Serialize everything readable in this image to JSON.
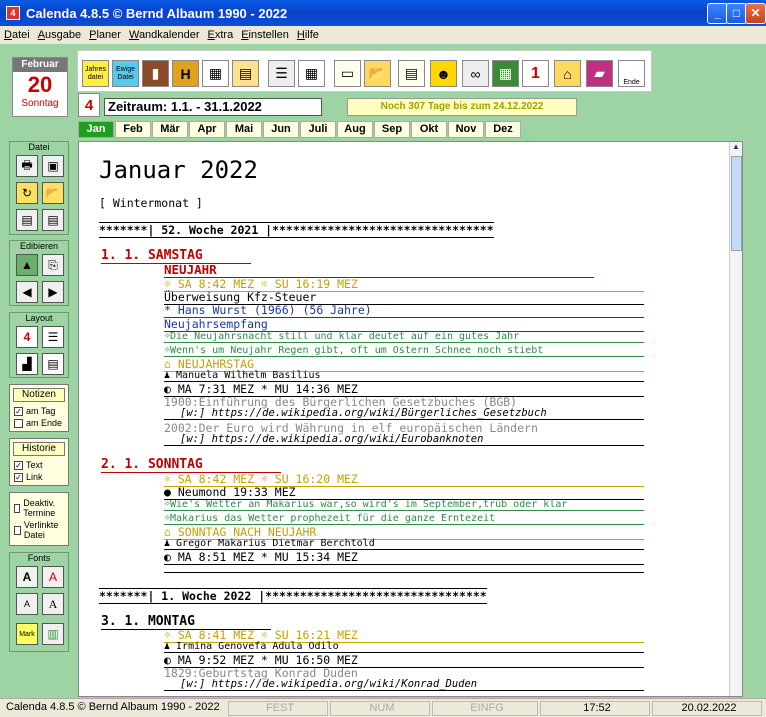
{
  "window": {
    "title": "Calenda 4.8.5  © Bernd Albaum 1990 - 2022",
    "icon": "4"
  },
  "menu": [
    "Datei",
    "Ausgabe",
    "Planer",
    "Wandkalender",
    "Extra",
    "Einstellen",
    "Hilfe"
  ],
  "toolbar": {
    "icons": [
      "jahres-datei-icon",
      "ewige-datei-icon",
      "book-icon",
      "h-icon",
      "calendar-grid-icon",
      "calendar-month-icon",
      "list-icon",
      "grid-icon",
      "note-icon",
      "folder-icon",
      "document-icon",
      "smiley-icon",
      "binoculars-icon",
      "calculator-icon",
      "day-calendar-icon",
      "house-icon",
      "books-icon",
      "exit-icon"
    ],
    "jahres": "Jahres datei",
    "ewige": "Ewige Datei",
    "exit": "Ende",
    "day_num": "1"
  },
  "datebox": {
    "month": "Februar",
    "day": "20",
    "weekday": "Sonntag"
  },
  "cal4": "4",
  "zeitraum": "Zeitraum:  1.1. - 31.1.2022",
  "countdown": "Noch 307 Tage bis zum 24.12.2022",
  "months": [
    "Jan",
    "Feb",
    "Mär",
    "Apr",
    "Mai",
    "Jun",
    "Juli",
    "Aug",
    "Sep",
    "Okt",
    "Nov",
    "Dez"
  ],
  "active_month": 0,
  "sidebar": {
    "datei": "Datei",
    "edit": "Edibieren",
    "layout": "Layout",
    "layout_num": "4",
    "fonts": "Fonts",
    "mark": "Mark",
    "notizen": {
      "title": "Notizen",
      "items": [
        {
          "label": "am Tag",
          "checked": true
        },
        {
          "label": "am Ende",
          "checked": false
        }
      ]
    },
    "historie": {
      "title": "Historie",
      "items": [
        {
          "label": "Text",
          "checked": true
        },
        {
          "label": "Link",
          "checked": true
        }
      ]
    },
    "extra": [
      {
        "label": "Deaktiv. Termine",
        "checked": false
      },
      {
        "label": "Verlinkte Datei",
        "checked": false
      }
    ]
  },
  "content": {
    "title": "Januar 2022",
    "subtitle": "[ Wintermonat ]",
    "week1": "*******| 52. Woche 2021 |********************************",
    "day1": {
      "head": "1. 1. SAMSTAG",
      "holiday": "NEUJAHR",
      "sun": "☼ SA  8:42 MEZ  ☼ SU 16:19 MEZ",
      "lines": [
        "Überweisung Kfz-Steuer",
        "* Hans Wurst (1966) (56 Jahre)",
        "Neujahrsempfang"
      ],
      "weather": [
        "☼Die Neujahrsnacht still und klar deutet auf ein gutes Jahr",
        "☼Wenn's um Neujahr Regen gibt, oft um Ostern Schnee noch stiebt"
      ],
      "feast": "⌂ NEUJAHRSTAG",
      "names": "♟ Manuela Wilhelm Basilius",
      "moon": "◐ MA  7:31 MEZ * MU 14:36 MEZ",
      "history": [
        {
          "text": "1900:Einführung des Bürgerlichen Gesetzbuches (BGB)",
          "link": "[w:] https://de.wikipedia.org/wiki/Bürgerliches_Gesetzbuch"
        },
        {
          "text": "2002:Der Euro wird Währung in elf europäischen Ländern",
          "link": "[w:] https://de.wikipedia.org/wiki/Eurobanknoten"
        }
      ]
    },
    "day2": {
      "head": "2. 1. SONNTAG",
      "sun": "☼ SA  8:42 MEZ  ☼ SU 16:20 MEZ",
      "neumond": "● Neumond 19:33 MEZ",
      "weather": [
        "☼Wie's Wetter an Makarius war,so wird's im September,trüb oder klar",
        "☼Makarius das Wetter prophezeit für die ganze Erntezeit"
      ],
      "feast": "⌂ SONNTAG NACH NEUJAHR",
      "names": "♟ Gregor Makarius Dietmar Berchtold",
      "moon": "◐ MA  8:51 MEZ * MU 15:34 MEZ"
    },
    "week2": "*******|  1. Woche 2022 |********************************",
    "day3": {
      "head": "3. 1. MONTAG",
      "sun": "☼ SA  8:41 MEZ  ☼ SU 16:21 MEZ",
      "names": "♟ Irmina Genovefa Adula Odilo",
      "moon": "◐ MA  9:52 MEZ * MU 16:50 MEZ",
      "history": "1829:Geburtstag Konrad Duden",
      "link": "[w:] https://de.wikipedia.org/wiki/Konrad_Duden"
    }
  },
  "colors": {
    "red": "#c00000",
    "gold": "#c8a000",
    "blue": "#1a3a9a",
    "green": "#2e8b4b",
    "gray": "#888888"
  },
  "status": {
    "app": "Calenda 4.8.5  ©  Bernd Albaum 1990 - 2022",
    "fest": "FEST",
    "num": "NUM",
    "einfg": "EINFG",
    "time": "17:52",
    "date": "20.02.2022"
  }
}
